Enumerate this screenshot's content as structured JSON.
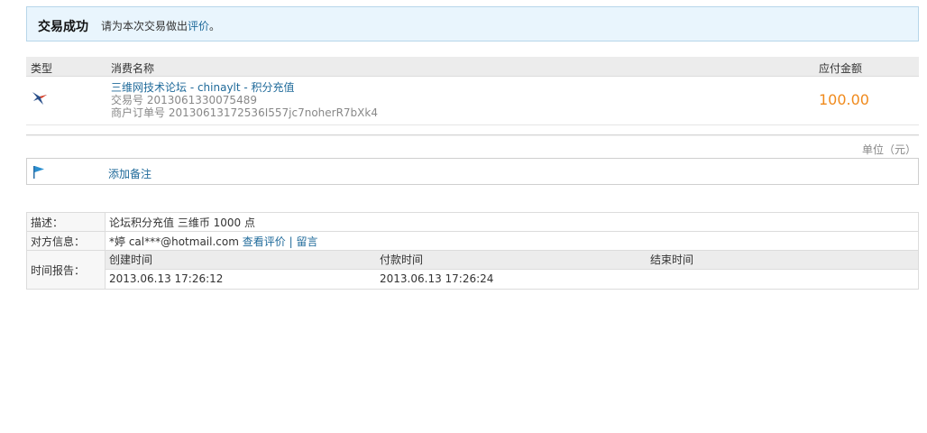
{
  "status": {
    "title": "交易成功",
    "prompt_text": "请为本次交易做出",
    "review_link": "评价",
    "prompt_end": "。"
  },
  "order": {
    "headers": {
      "type": "类型",
      "name": "消费名称",
      "amount": "应付金额"
    },
    "item": {
      "name": "三维网技术论坛 - chinaylt - 积分充值",
      "trade_no": "交易号 2013061330075489",
      "merchant_order_no": "商户订单号 20130613172536I557jc7noherR7bXk4",
      "amount": "100.00"
    },
    "unit": "单位（元）"
  },
  "memo": {
    "add_note_label": "添加备注"
  },
  "details": {
    "description_label": "描述：",
    "description_value": "论坛积分充值 三维币 1000 点",
    "counterparty_label": "对方信息：",
    "counterparty_value": "*婷 cal***@hotmail.com",
    "view_review_link": "查看评价",
    "separator": "|",
    "message_link": "留言",
    "time_label": "时间报告：",
    "time_headers": [
      "创建时间",
      "付款时间",
      "结束时间"
    ],
    "time_values": [
      "2013.06.13 17:26:12",
      "2013.06.13 17:26:24",
      ""
    ]
  },
  "colors": {
    "link": "#1f6a9a",
    "price": "#f08a1c",
    "success_bg": "#e9f5fd"
  }
}
